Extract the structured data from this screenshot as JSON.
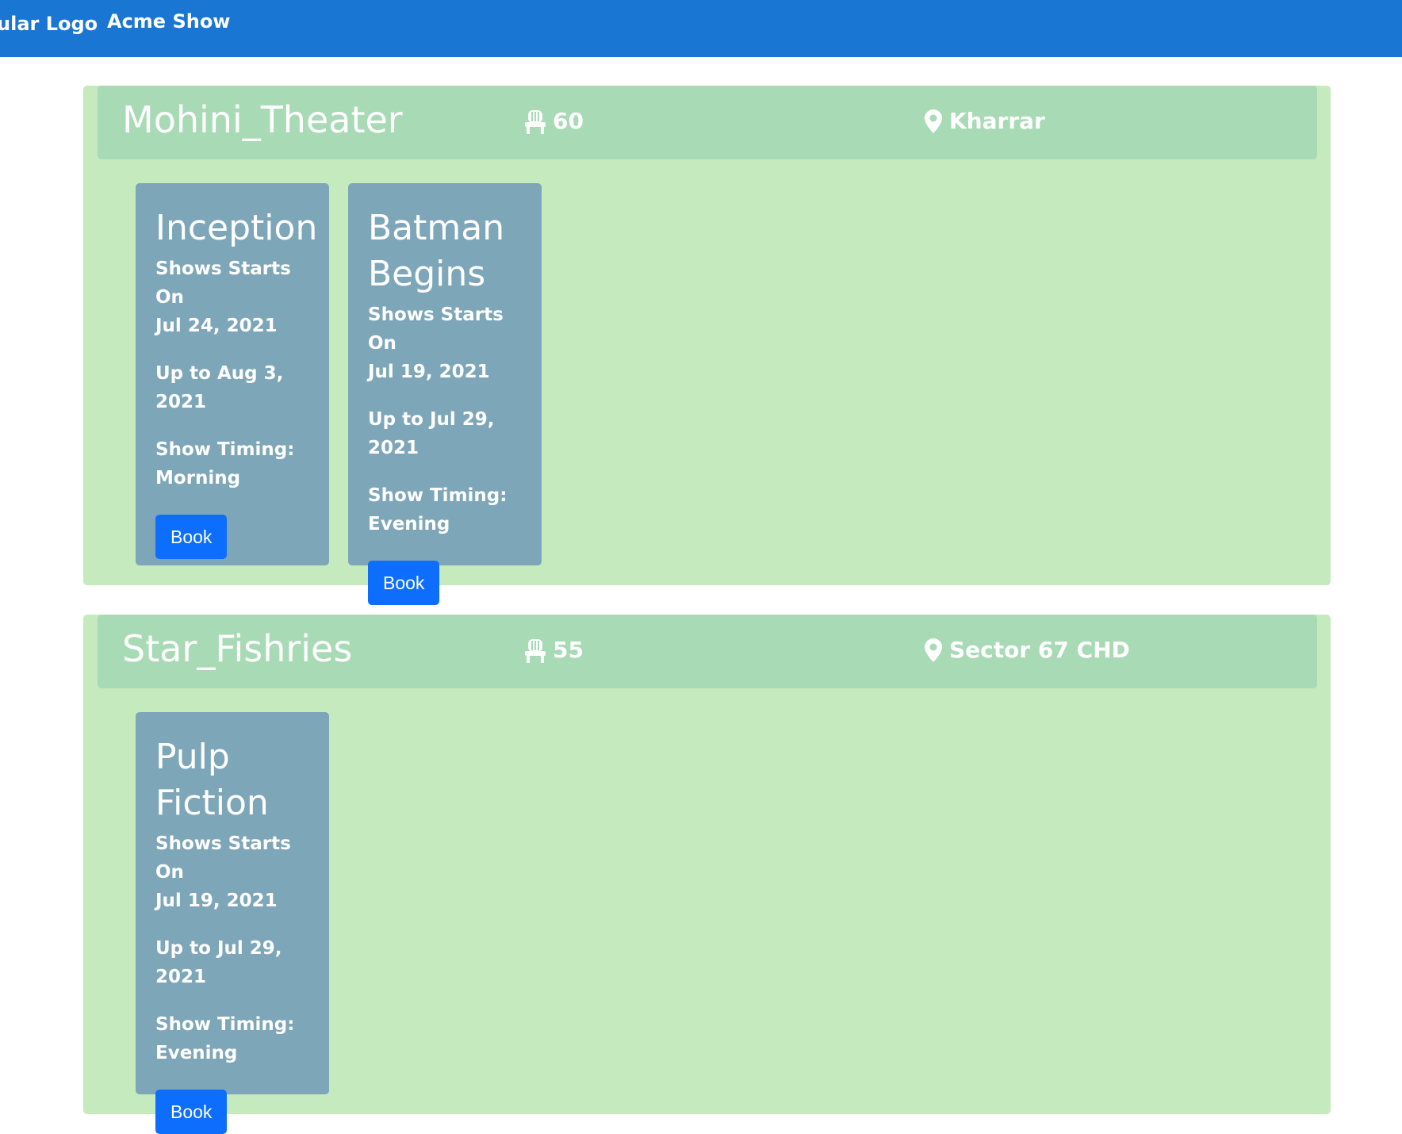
{
  "navbar": {
    "brand": "ular Logo",
    "link": "Acme Show"
  },
  "theaters": [
    {
      "name": "Mohini_Theater",
      "seats": "60",
      "location": "Kharrar",
      "movies": [
        {
          "title": "Inception",
          "starts_label": "Shows Starts On",
          "starts_date": "Jul 24, 2021",
          "up_to": "Up to Aug 3, 2021",
          "timing_label": "Show Timing:",
          "timing_value": "Morning",
          "button": "Book"
        },
        {
          "title": "Batman Begins",
          "starts_label": "Shows Starts On",
          "starts_date": "Jul 19, 2021",
          "up_to": "Up to Jul 29, 2021",
          "timing_label": "Show Timing:",
          "timing_value": "Evening",
          "button": "Book"
        }
      ]
    },
    {
      "name": "Star_Fishries",
      "seats": "55",
      "location": "Sector 67 CHD",
      "movies": [
        {
          "title": "Pulp Fiction",
          "starts_label": "Shows Starts On",
          "starts_date": "Jul 19, 2021",
          "up_to": "Up to Jul 29, 2021",
          "timing_label": "Show Timing:",
          "timing_value": "Evening",
          "button": "Book"
        }
      ]
    }
  ],
  "colors": {
    "navbar": "#1976d2",
    "theater_bg": "#c5eabe",
    "theater_header": "#a8dab5",
    "card": "#7da6b8",
    "button": "#0d6efd"
  },
  "icons": {
    "seats": "seat-icon",
    "location": "map-pin-icon"
  }
}
